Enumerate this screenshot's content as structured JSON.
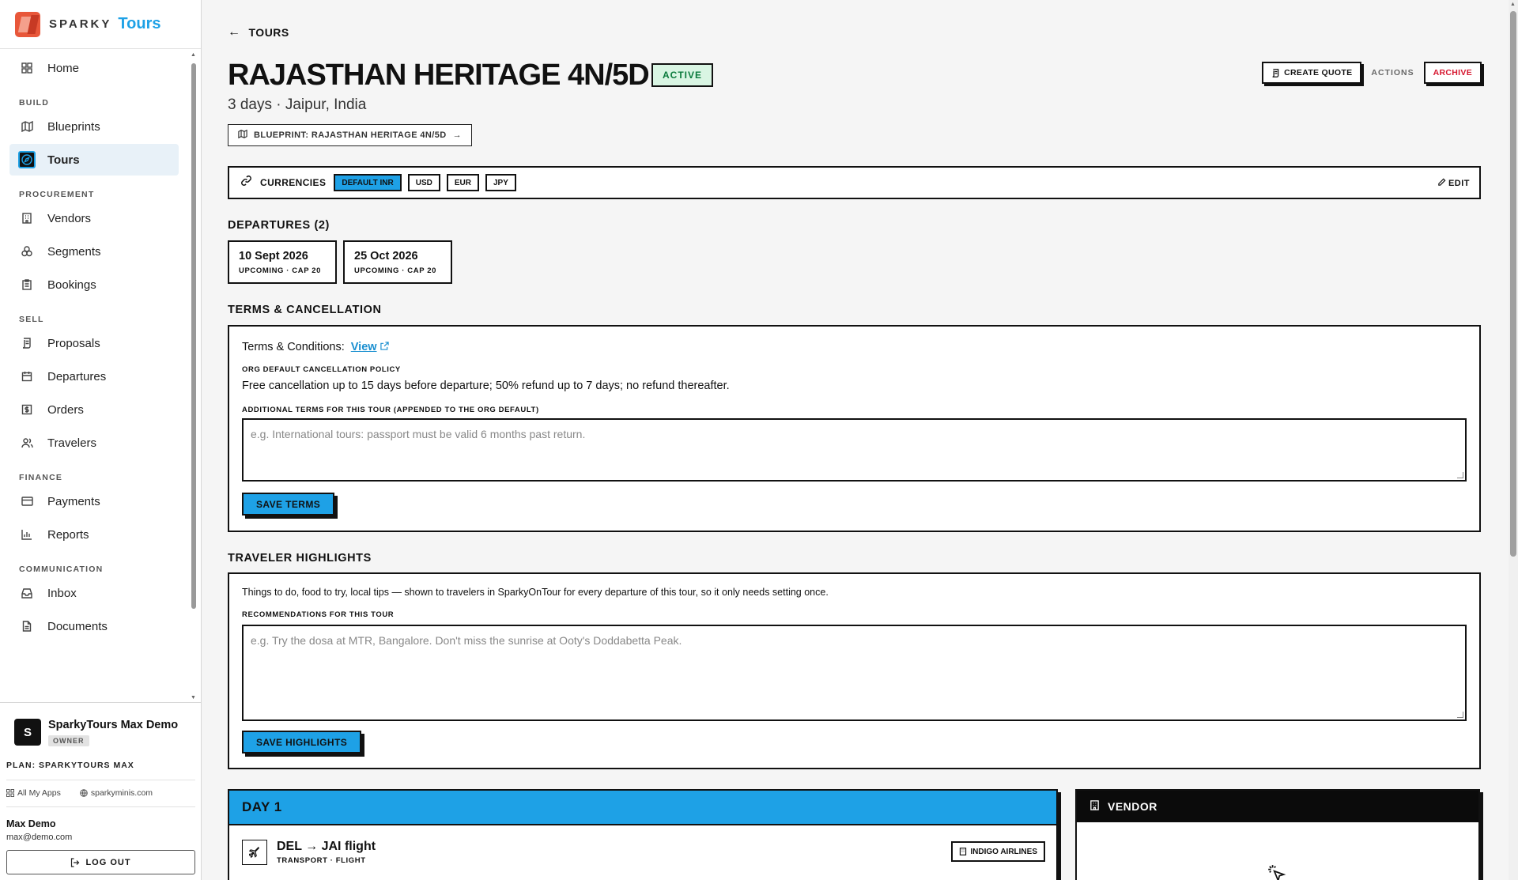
{
  "brand": {
    "name": "SPARKY",
    "product": "Tours"
  },
  "nav": {
    "home": "Home",
    "sections": {
      "build": "BUILD",
      "procurement": "PROCUREMENT",
      "sell": "SELL",
      "finance": "FINANCE",
      "communication": "COMMUNICATION"
    },
    "items": {
      "blueprints": "Blueprints",
      "tours": "Tours",
      "vendors": "Vendors",
      "segments": "Segments",
      "bookings": "Bookings",
      "proposals": "Proposals",
      "departures": "Departures",
      "orders": "Orders",
      "travelers": "Travelers",
      "payments": "Payments",
      "reports": "Reports",
      "inbox": "Inbox",
      "documents": "Documents"
    },
    "active": "tours"
  },
  "footer": {
    "org_initial": "S",
    "org_name": "SparkyTours Max Demo",
    "role": "OWNER",
    "plan": "PLAN: SPARKYTOURS MAX",
    "all_apps": "All My Apps",
    "site": "sparkyminis.com",
    "user_name": "Max Demo",
    "user_email": "max@demo.com",
    "logout": "LOG OUT"
  },
  "page": {
    "back_label": "TOURS",
    "title": "RAJASTHAN HERITAGE 4N/5D",
    "status": "ACTIVE",
    "subtitle": "3 days · Jaipur, India",
    "blueprint_link": "BLUEPRINT: RAJASTHAN HERITAGE 4N/5D",
    "create_quote": "CREATE QUOTE",
    "actions_label": "ACTIONS",
    "archive": "ARCHIVE"
  },
  "currencies": {
    "label": "CURRENCIES",
    "items": [
      "DEFAULT INR",
      "USD",
      "EUR",
      "JPY"
    ],
    "edit": "EDIT"
  },
  "departures": {
    "heading": "DEPARTURES (2)",
    "items": [
      {
        "date": "10 Sept 2026",
        "status": "UPCOMING · CAP 20"
      },
      {
        "date": "25 Oct 2026",
        "status": "UPCOMING · CAP 20"
      }
    ]
  },
  "terms": {
    "heading": "TERMS & CANCELLATION",
    "tc_label": "Terms & Conditions:",
    "tc_link": "View",
    "policy_label": "ORG DEFAULT CANCELLATION POLICY",
    "policy_text": "Free cancellation up to 15 days before departure; 50% refund up to 7 days; no refund thereafter.",
    "additional_label": "ADDITIONAL TERMS FOR THIS TOUR (APPENDED TO THE ORG DEFAULT)",
    "additional_placeholder": "e.g. International tours: passport must be valid 6 months past return.",
    "save": "SAVE TERMS"
  },
  "highlights": {
    "heading": "TRAVELER HIGHLIGHTS",
    "description": "Things to do, food to try, local tips — shown to travelers in SparkyOnTour for every departure of this tour, so it only needs setting once.",
    "label": "RECOMMENDATIONS FOR THIS TOUR",
    "placeholder": "e.g. Try the dosa at MTR, Bangalore. Don't miss the sunrise at Ooty's Doddabetta Peak.",
    "save": "SAVE HIGHLIGHTS"
  },
  "day": {
    "title": "DAY 1",
    "segment_title": "DEL → JAI flight",
    "segment_sub": "TRANSPORT · FLIGHT",
    "vendor": "INDIGO AIRLINES"
  },
  "vendor_panel": {
    "title": "VENDOR"
  },
  "colors": {
    "accent": "#1ea1e6",
    "active_bg": "#d9f5e3",
    "danger": "#d6162f"
  }
}
